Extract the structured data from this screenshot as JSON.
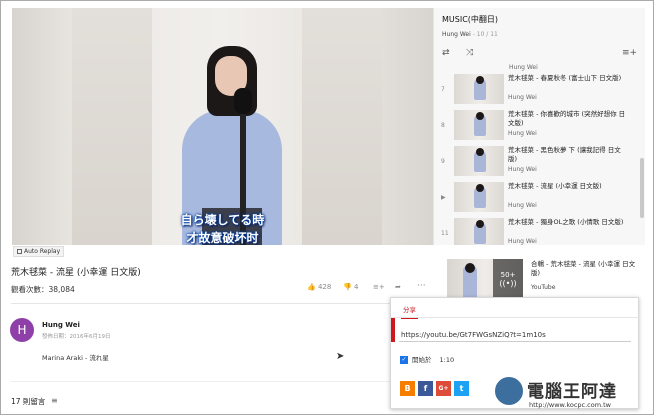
{
  "video": {
    "subtitle_line1": "自ら壊してる時",
    "subtitle_line2": "才故意破坏时",
    "autoreplay_label": "Auto Replay"
  },
  "playlist": {
    "title": "MUSIC(中翻日)",
    "owner": "Hung Wei",
    "position": " - 10 / 11",
    "top_partial_author": "Hung Wei",
    "items": [
      {
        "index": "7",
        "title": "荒木毬菜 - 春夏秋冬 (富士山下 日文版)",
        "author": "Hung Wei"
      },
      {
        "index": "8",
        "title": "荒木毬菜 - 你喜歡的城市 (突然好想你 日文版)",
        "author": "Hung Wei"
      },
      {
        "index": "9",
        "title": "荒木毬菜 - 黑色秋夢 下 (讓我記得 日文版)",
        "author": "Hung Wei"
      },
      {
        "index": "▶",
        "title": "荒木毬菜 - 流星 (小幸運 日文版)",
        "author": "Hung Wei"
      },
      {
        "index": "11",
        "title": "荒木毬菜 - 獨身OL之歌 (小情歌 日文版)",
        "author": "Hung Wei"
      }
    ]
  },
  "main": {
    "title": "荒木毬菜 - 流星 (小幸運 日文版)",
    "views": "觀看次數：38,084",
    "likes": "428",
    "dislikes": "4"
  },
  "channel": {
    "avatar_letter": "H",
    "name": "Hung Wei",
    "published": "發佈日期：2016年6月19日",
    "description": "Marina Araki - 流れ星"
  },
  "comments": {
    "count": "17 則留言"
  },
  "related": {
    "title": "合輯 - 荒木毬菜 - 流星 (小幸運 日文版)",
    "subtitle": "YouTube",
    "count": "50+"
  },
  "share": {
    "tab_label": "分享",
    "url": "https://youtu.be/Gt7FWGsNZiQ?t=1m10s",
    "start_label": "開始於",
    "start_time": "1:10",
    "colors": {
      "blogger": "#f57d00",
      "facebook": "#3b5998",
      "google_plus": "#dd4b39",
      "twitter": "#1da1f2"
    }
  },
  "watermark": {
    "big_text": "電腦王阿達",
    "small_text": "http://www.kocpc.com.tw"
  }
}
